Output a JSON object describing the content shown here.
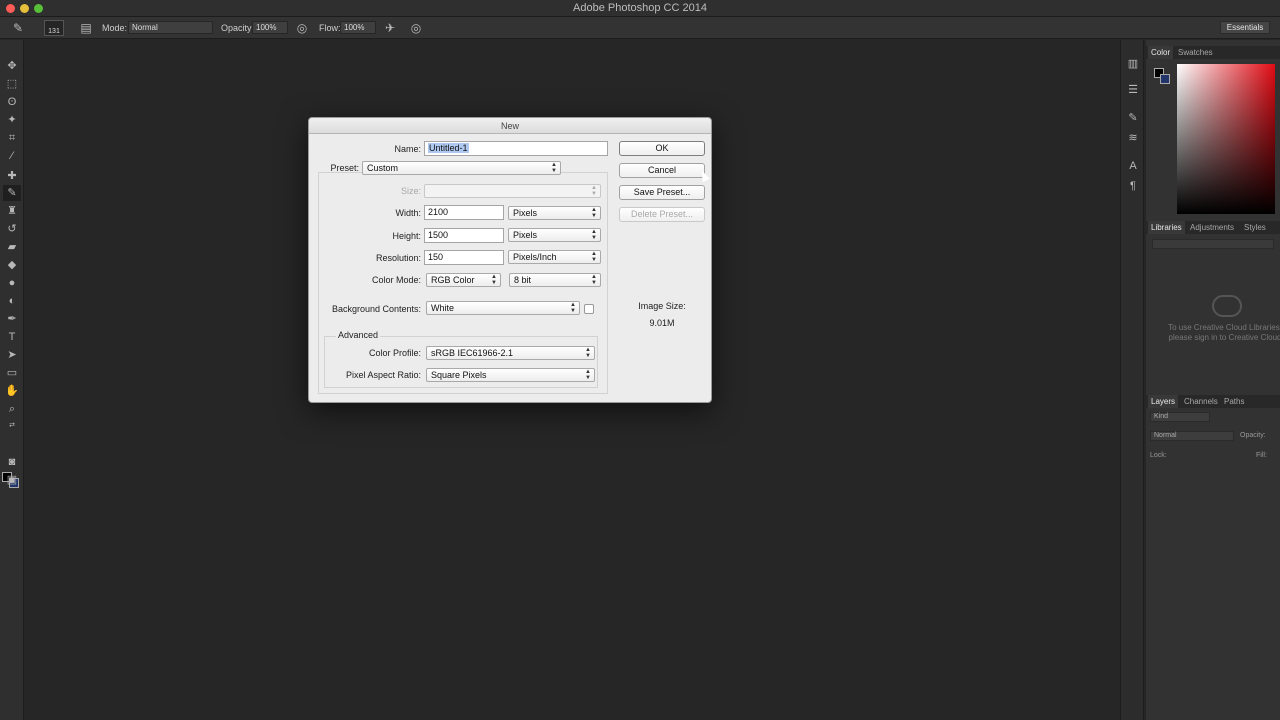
{
  "app": {
    "title": "Adobe Photoshop CC 2014"
  },
  "options_bar": {
    "brush_size": "131",
    "mode_label": "Mode:",
    "mode_value": "Normal",
    "opacity_label": "Opacity:",
    "opacity_value": "100%",
    "flow_label": "Flow:",
    "flow_value": "100%",
    "workspace": "Essentials"
  },
  "panels": {
    "color_tabs": [
      "Color",
      "Swatches"
    ],
    "libraries_tabs": [
      "Libraries",
      "Adjustments",
      "Styles"
    ],
    "libraries_message": "To use Creative Cloud Libraries, please sign in to Creative Cloud",
    "layers_tabs": [
      "Layers",
      "Channels",
      "Paths"
    ],
    "layers_kind": "Kind",
    "layers_blend": "Normal",
    "layers_opacity_label": "Opacity:",
    "layers_lock_label": "Lock:",
    "layers_fill_label": "Fill:",
    "foreground_color": "#000000",
    "background_color": "#22356b"
  },
  "dialog": {
    "title": "New",
    "name_label": "Name:",
    "name_value": "Untitled-1",
    "preset_label": "Preset:",
    "preset_value": "Custom",
    "size_label": "Size:",
    "size_value": "",
    "width_label": "Width:",
    "width_value": "2100",
    "width_unit": "Pixels",
    "height_label": "Height:",
    "height_value": "1500",
    "height_unit": "Pixels",
    "resolution_label": "Resolution:",
    "resolution_value": "150",
    "resolution_unit": "Pixels/Inch",
    "color_mode_label": "Color Mode:",
    "color_mode_value": "RGB Color",
    "bit_depth": "8 bit",
    "bg_contents_label": "Background Contents:",
    "bg_contents_value": "White",
    "advanced_label": "Advanced",
    "color_profile_label": "Color Profile:",
    "color_profile_value": "sRGB IEC61966-2.1",
    "pixel_aspect_label": "Pixel Aspect Ratio:",
    "pixel_aspect_value": "Square Pixels",
    "ok_label": "OK",
    "cancel_label": "Cancel",
    "save_preset_label": "Save Preset...",
    "delete_preset_label": "Delete Preset...",
    "image_size_label": "Image Size:",
    "image_size_value": "9.01M"
  }
}
